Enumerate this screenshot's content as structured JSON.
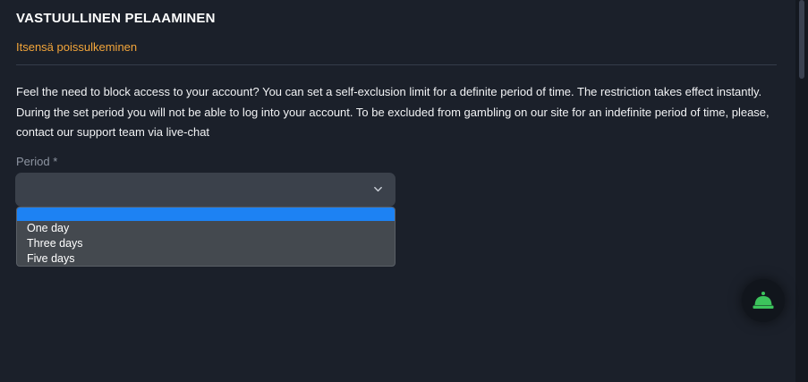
{
  "section": {
    "title": "VASTUULLINEN PELAAMINEN",
    "subtitle": "Itsensä poissulkeminen"
  },
  "description": "Feel the need to block access to your account? You can set a self-exclusion limit for a definite period of time. The restriction takes effect instantly. During the set period you will not be able to log into your account. To be excluded from gambling on our site for an indefinite period of time, please, contact our support team via live-chat",
  "period_field": {
    "label": "Period *",
    "value": "",
    "icon": "chevron-down-icon",
    "options": [
      "",
      "One day",
      "Three days",
      "Five days"
    ]
  },
  "support_button": {
    "icon": "service-bell-icon",
    "color": "#3cc35c"
  },
  "colors": {
    "background": "#1b202a",
    "accent": "#f3a53a",
    "selected_option": "#1d82f3"
  }
}
